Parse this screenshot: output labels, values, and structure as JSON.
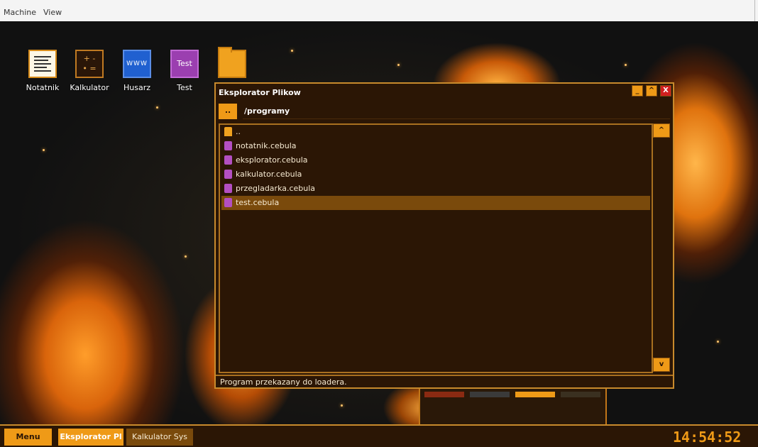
{
  "host_menu": {
    "machine": "Machine",
    "view": "View"
  },
  "desktop_icons": [
    {
      "label": "Notatnik"
    },
    {
      "label": "Kalkulator",
      "glyph": "+ -\n• ="
    },
    {
      "label": "Husarz",
      "glyph": "WWW"
    },
    {
      "label": "Test",
      "glyph": "Test"
    },
    {
      "label": ""
    }
  ],
  "explorer": {
    "title": "Eksplorator Plikow",
    "buttons": {
      "minimize": "_",
      "maximize": "^",
      "close": "X"
    },
    "up_label": "..",
    "path": "/programy",
    "items": [
      {
        "name": "..",
        "type": "folder"
      },
      {
        "name": "notatnik.cebula",
        "type": "file"
      },
      {
        "name": "eksplorator.cebula",
        "type": "file"
      },
      {
        "name": "kalkulator.cebula",
        "type": "file"
      },
      {
        "name": "przegladarka.cebula",
        "type": "file"
      },
      {
        "name": "test.cebula",
        "type": "file",
        "selected": true
      }
    ],
    "scroll_up": "^",
    "scroll_down": "v",
    "status": "Program przekazany do loadera."
  },
  "taskbar": {
    "menu": "Menu",
    "tasks": [
      "Eksplorator Pl",
      "Kalkulator Sys"
    ],
    "clock": "14:54:52"
  },
  "colors": {
    "accent": "#ef9a17",
    "window_bg": "#2b1605",
    "selection": "#7a4a0c",
    "close": "#d11f1f"
  }
}
